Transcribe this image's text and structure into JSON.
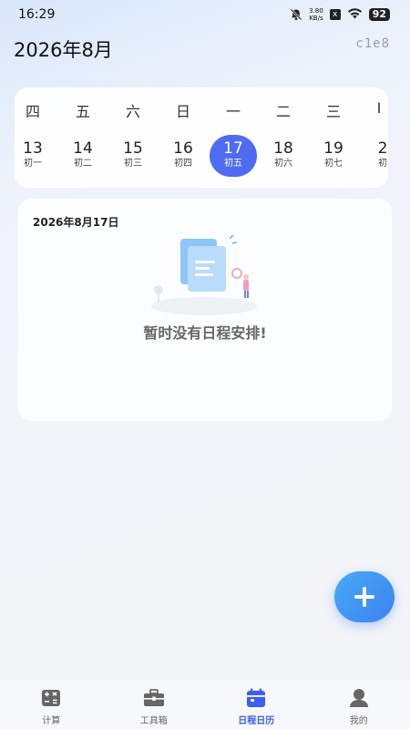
{
  "status_bar": {
    "time": "16:29",
    "net_speed_value": "3.80",
    "net_speed_unit": "KB/s",
    "x_badge": "x",
    "battery": "92"
  },
  "header": {
    "month_title": "2026年8月",
    "code": "c1e8"
  },
  "week": {
    "weekday_labels": [
      "四",
      "五",
      "六",
      "日",
      "一",
      "二",
      "三",
      "I"
    ],
    "days": [
      {
        "num": "13",
        "lunar": "初一"
      },
      {
        "num": "14",
        "lunar": "初二"
      },
      {
        "num": "15",
        "lunar": "初三"
      },
      {
        "num": "16",
        "lunar": "初四"
      },
      {
        "num": "17",
        "lunar": "初五"
      },
      {
        "num": "18",
        "lunar": "初六"
      },
      {
        "num": "19",
        "lunar": "初七"
      },
      {
        "num": "2",
        "lunar": "初"
      }
    ],
    "selected_num": "17"
  },
  "schedule": {
    "date_label": "2026年8月17日",
    "empty_text": "暂时没有日程安排!"
  },
  "tabbar": {
    "tabs": [
      {
        "label": "计算",
        "icon": "calculator-icon",
        "active": false
      },
      {
        "label": "工具箱",
        "icon": "toolbox-icon",
        "active": false
      },
      {
        "label": "日程日历",
        "icon": "calendar-icon",
        "active": true
      },
      {
        "label": "我的",
        "icon": "person-icon",
        "active": false
      }
    ]
  },
  "colors": {
    "accent": "#4e6bf1",
    "fab": "#3b82f0",
    "active_tab": "#3d5ef0"
  }
}
